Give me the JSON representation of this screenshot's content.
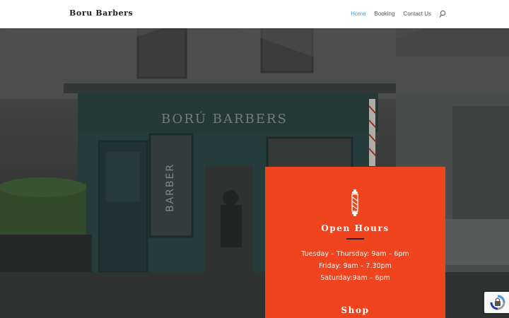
{
  "header": {
    "logo": "Boru Barbers",
    "nav": [
      {
        "label": "Home",
        "active": true
      },
      {
        "label": "Booking",
        "active": false
      },
      {
        "label": "Contact Us",
        "active": false
      }
    ]
  },
  "hero": {
    "sign_text": "BORÚ BARBERS",
    "window_text": "BARBER"
  },
  "card": {
    "title": "Open Hours",
    "hours": [
      "Tuesday – Thursday: 9am – 6pm",
      "Friday: 9am – 7.30pm",
      "Saturday:9am – 6pm"
    ],
    "shop_title": "Shop"
  },
  "colors": {
    "accent_nav": "#2ea3f2",
    "card_bg": "#f0441f",
    "storefront": "#2e4a48"
  },
  "icons": {
    "search": "search-icon",
    "barber_pole": "barber-pole-icon",
    "recaptcha": "recaptcha-icon"
  }
}
